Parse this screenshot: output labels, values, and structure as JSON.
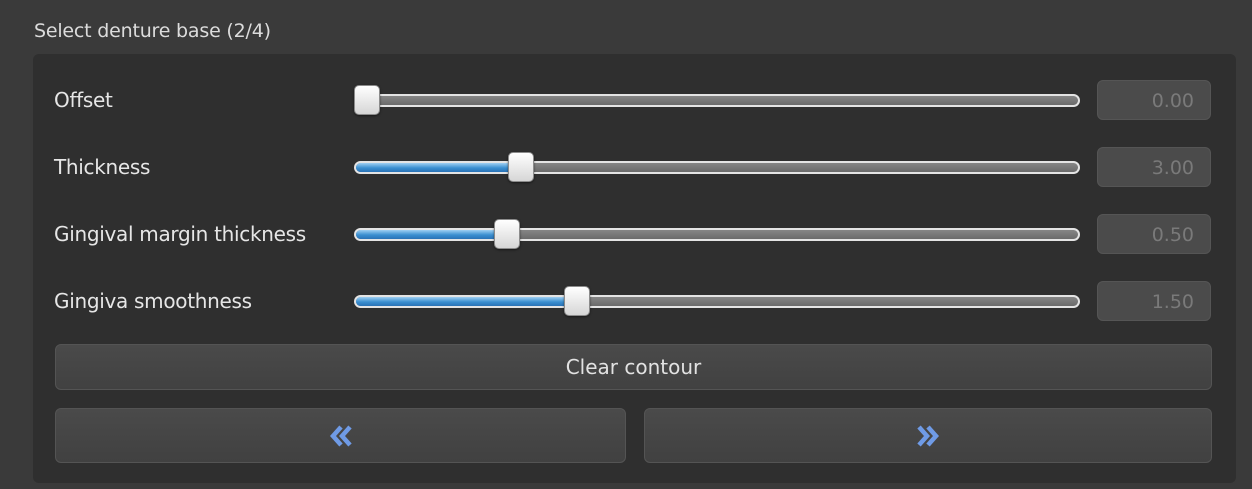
{
  "header": {
    "title": "Select denture base (2/4)"
  },
  "sliders": [
    {
      "label": "Offset",
      "value": "0.00",
      "fraction": 0.0
    },
    {
      "label": "Thickness",
      "value": "3.00",
      "fraction": 0.22
    },
    {
      "label": "Gingival margin thickness",
      "value": "0.50",
      "fraction": 0.2
    },
    {
      "label": "Gingiva smoothness",
      "value": "1.50",
      "fraction": 0.3
    }
  ],
  "buttons": {
    "clear_contour": "Clear contour",
    "prev_icon": "double-chevron-left-icon",
    "next_icon": "double-chevron-right-icon"
  },
  "colors": {
    "accent": "#3b8fd0",
    "nav_arrow": "#6f9be6",
    "background": "#3a3a3a",
    "panel": "#2f2f2f"
  }
}
